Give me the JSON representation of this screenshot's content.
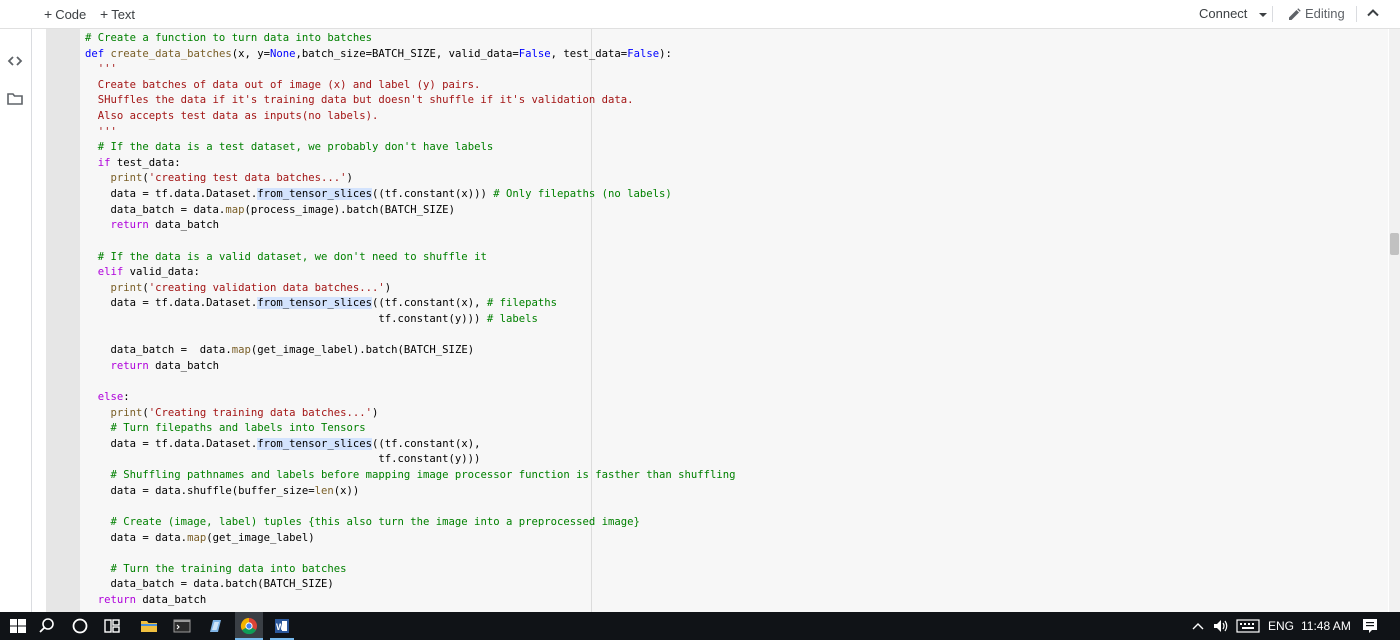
{
  "toolbar": {
    "code_label": "Code",
    "text_label": "Text",
    "connect_label": "Connect",
    "editing_label": "Editing"
  },
  "code_lines": [
    "# Create a function to turn data into batches",
    "def create_data_batches(x, y=None,batch_size=BATCH_SIZE, valid_data=False, test_data=False):",
    "  '''",
    "  Create batches of data out of image (x) and label (y) pairs.",
    "  SHuffles the data if it's training data but doesn't shuffle if it's validation data.",
    "  Also accepts test data as inputs(no labels).",
    "  '''",
    "  # If the data is a test dataset, we probably don't have labels",
    "  if test_data:",
    "    print('creating test data batches...')",
    "    data = tf.data.Dataset.from_tensor_slices((tf.constant(x))) # Only filepaths (no labels)",
    "    data_batch = data.map(process_image).batch(BATCH_SIZE)",
    "    return data_batch",
    "",
    "  # If the data is a valid dataset, we don't need to shuffle it",
    "  elif valid_data:",
    "    print('creating validation data batches...')",
    "    data = tf.data.Dataset.from_tensor_slices((tf.constant(x), # filepaths",
    "                                              tf.constant(y))) # labels",
    "",
    "    data_batch =  data.map(get_image_label).batch(BATCH_SIZE)",
    "    return data_batch",
    "",
    "  else:",
    "    print('Creating training data batches...')",
    "    # Turn filepaths and labels into Tensors",
    "    data = tf.data.Dataset.from_tensor_slices((tf.constant(x),",
    "                                              tf.constant(y)))",
    "    # Shuffling pathnames and labels before mapping image processor function is fasther than shuffling",
    "    data = data.shuffle(buffer_size=len(x))",
    "",
    "    # Create (image, label) tuples {this also turn the image into a preprocessed image}",
    "    data = data.map(get_image_label)",
    "",
    "    # Turn the training data into batches",
    "    data_batch = data.batch(BATCH_SIZE)",
    "  return data_batch"
  ],
  "taskbar": {
    "language": "ENG",
    "time": "11:48 AM"
  },
  "colors": {
    "comment": "#008000",
    "keyword": "#0000ff",
    "control": "#af00db",
    "string": "#a31515",
    "function": "#795e26",
    "taskbar_bg": "#101317",
    "highlight": "#d3e3fd"
  }
}
